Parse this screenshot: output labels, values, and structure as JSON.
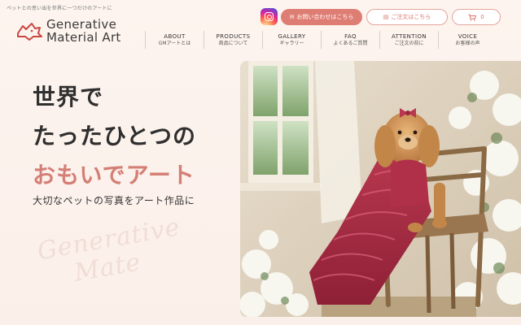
{
  "header": {
    "tagline": "ペットとの思い出を世界に一つだけのアートに",
    "logo_line1": "Generative",
    "logo_line2": "Material Art",
    "contact_label": "お問い合わせはこちら",
    "order_label": "ご注文はこちら",
    "cart_count": "0"
  },
  "nav": [
    {
      "en": "ABOUT",
      "ja": "GMアートとは"
    },
    {
      "en": "PRODUCTS",
      "ja": "商品について"
    },
    {
      "en": "GALLERY",
      "ja": "ギャラリー"
    },
    {
      "en": "FAQ",
      "ja": "よくあるご質問"
    },
    {
      "en": "ATTENTION",
      "ja": "ご注文の前に"
    },
    {
      "en": "VOICE",
      "ja": "お客様の声"
    }
  ],
  "hero": {
    "line1": "世界で",
    "line2": "たったひとつの",
    "line3": "おもいでアート",
    "subtitle": "大切なペットの写真をアート作品に",
    "watermark_line1": "Generative",
    "watermark_line2": "Mate"
  },
  "colors": {
    "accent": "#de7d73",
    "background": "#fdf4ef",
    "text": "#2f2f2f"
  },
  "icons": {
    "instagram": "instagram-icon",
    "mail": "mail-icon",
    "cart": "cart-icon",
    "logo": "cat-logo-icon"
  }
}
